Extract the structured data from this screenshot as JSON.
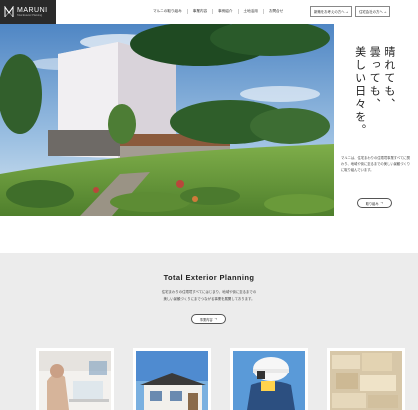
{
  "brand": {
    "name": "MARUNI",
    "tagline": "Total Exterior Planning"
  },
  "nav": {
    "items": [
      "マルニの取り組み",
      "事業内容",
      "事例紹介",
      "土地活用",
      "お問合せ"
    ]
  },
  "header_cta": {
    "primary": "新築をお考えの方へ",
    "secondary": "住宅会社の方へ",
    "arrow": "→"
  },
  "hero": {
    "tagline_columns": [
      "晴れても、",
      "曇っても、",
      "美しい日々を。"
    ],
    "description": "マルニは、住宅まわりの住環境事業すべてに関わり、地域や街に至るまでの美しい景観づくりに取り組んでいます。",
    "button_label": "取り組み",
    "button_arrow": "→"
  },
  "section": {
    "title": "Total Exterior Planning",
    "description_lines": [
      "住宅まわりの住環境すべてにはじまり、地域や街に至るまでの",
      "美しい景観づくりにまでつながる事業を展開しております。"
    ],
    "button_label": "事業内容",
    "button_arrow": "→"
  },
  "cards": [
    {
      "icon": "office-meeting-photo"
    },
    {
      "icon": "house-exterior-photo"
    },
    {
      "icon": "surveyor-helmet-photo"
    },
    {
      "icon": "stone-blocks-photo"
    }
  ],
  "colors": {
    "logo_bg": "#2a2a2a",
    "section_bg": "#ececec",
    "sky": "#6fa0cf"
  }
}
